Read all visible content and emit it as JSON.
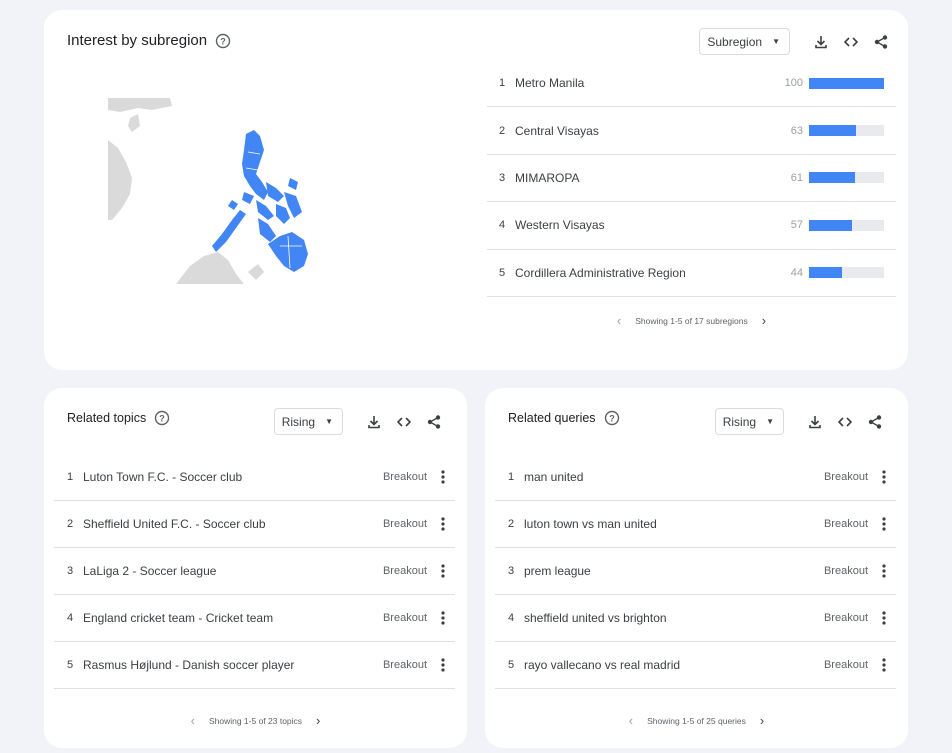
{
  "subregion": {
    "title": "Interest by subregion",
    "select_value": "Subregion",
    "items": [
      {
        "rank": "1",
        "name": "Metro Manila",
        "value": "100",
        "level": 100
      },
      {
        "rank": "2",
        "name": "Central Visayas",
        "value": "63",
        "level": 63
      },
      {
        "rank": "3",
        "name": "MIMAROPA",
        "value": "61",
        "level": 61
      },
      {
        "rank": "4",
        "name": "Western Visayas",
        "value": "57",
        "level": 57
      },
      {
        "rank": "5",
        "name": "Cordillera Administrative Region",
        "value": "44",
        "level": 44
      }
    ],
    "pager": "Showing 1-5 of 17 subregions"
  },
  "topics": {
    "title": "Related topics",
    "select_value": "Rising",
    "items": [
      {
        "rank": "1",
        "name": "Luton Town F.C. - Soccer club",
        "badge": "Breakout"
      },
      {
        "rank": "2",
        "name": "Sheffield United F.C. - Soccer club",
        "badge": "Breakout"
      },
      {
        "rank": "3",
        "name": "LaLiga 2 - Soccer league",
        "badge": "Breakout"
      },
      {
        "rank": "4",
        "name": "England cricket team - Cricket team",
        "badge": "Breakout"
      },
      {
        "rank": "5",
        "name": "Rasmus Højlund - Danish soccer player",
        "badge": "Breakout"
      }
    ],
    "pager": "Showing 1-5 of 23 topics"
  },
  "queries": {
    "title": "Related queries",
    "select_value": "Rising",
    "items": [
      {
        "rank": "1",
        "name": "man united",
        "badge": "Breakout"
      },
      {
        "rank": "2",
        "name": "luton town vs man united",
        "badge": "Breakout"
      },
      {
        "rank": "3",
        "name": "prem league",
        "badge": "Breakout"
      },
      {
        "rank": "4",
        "name": "sheffield united vs brighton",
        "badge": "Breakout"
      },
      {
        "rank": "5",
        "name": "rayo vallecano vs real madrid",
        "badge": "Breakout"
      }
    ],
    "pager": "Showing 1-5 of 25 queries"
  },
  "colors": {
    "accent": "#4285f4",
    "map_land": "#dadada",
    "card": "#ffffff",
    "background": "#f1f3f8"
  },
  "icons": [
    "help-icon",
    "download-icon",
    "embed-icon",
    "share-icon",
    "chevron-left-icon",
    "chevron-right-icon",
    "more-vert-icon",
    "dropdown-caret-icon"
  ]
}
